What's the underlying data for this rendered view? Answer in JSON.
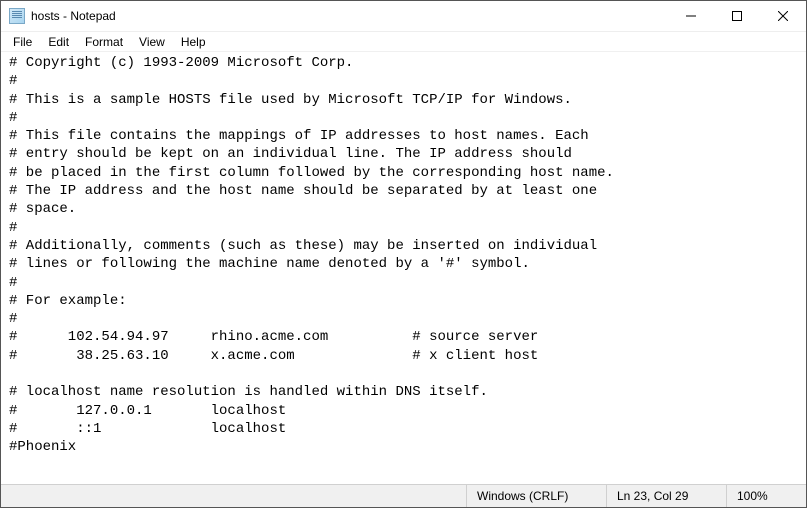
{
  "window": {
    "title": "hosts - Notepad"
  },
  "menus": {
    "file": "File",
    "edit": "Edit",
    "format": "Format",
    "view": "View",
    "help": "Help"
  },
  "editor": {
    "content": "# Copyright (c) 1993-2009 Microsoft Corp.\n#\n# This is a sample HOSTS file used by Microsoft TCP/IP for Windows.\n#\n# This file contains the mappings of IP addresses to host names. Each\n# entry should be kept on an individual line. The IP address should\n# be placed in the first column followed by the corresponding host name.\n# The IP address and the host name should be separated by at least one\n# space.\n#\n# Additionally, comments (such as these) may be inserted on individual\n# lines or following the machine name denoted by a '#' symbol.\n#\n# For example:\n#\n#      102.54.94.97     rhino.acme.com          # source server\n#       38.25.63.10     x.acme.com              # x client host\n\n# localhost name resolution is handled within DNS itself.\n#       127.0.0.1       localhost\n#       ::1             localhost\n#Phoenix"
  },
  "statusbar": {
    "line_ending": "Windows (CRLF)",
    "position": "Ln 23, Col 29",
    "zoom": "100%"
  }
}
